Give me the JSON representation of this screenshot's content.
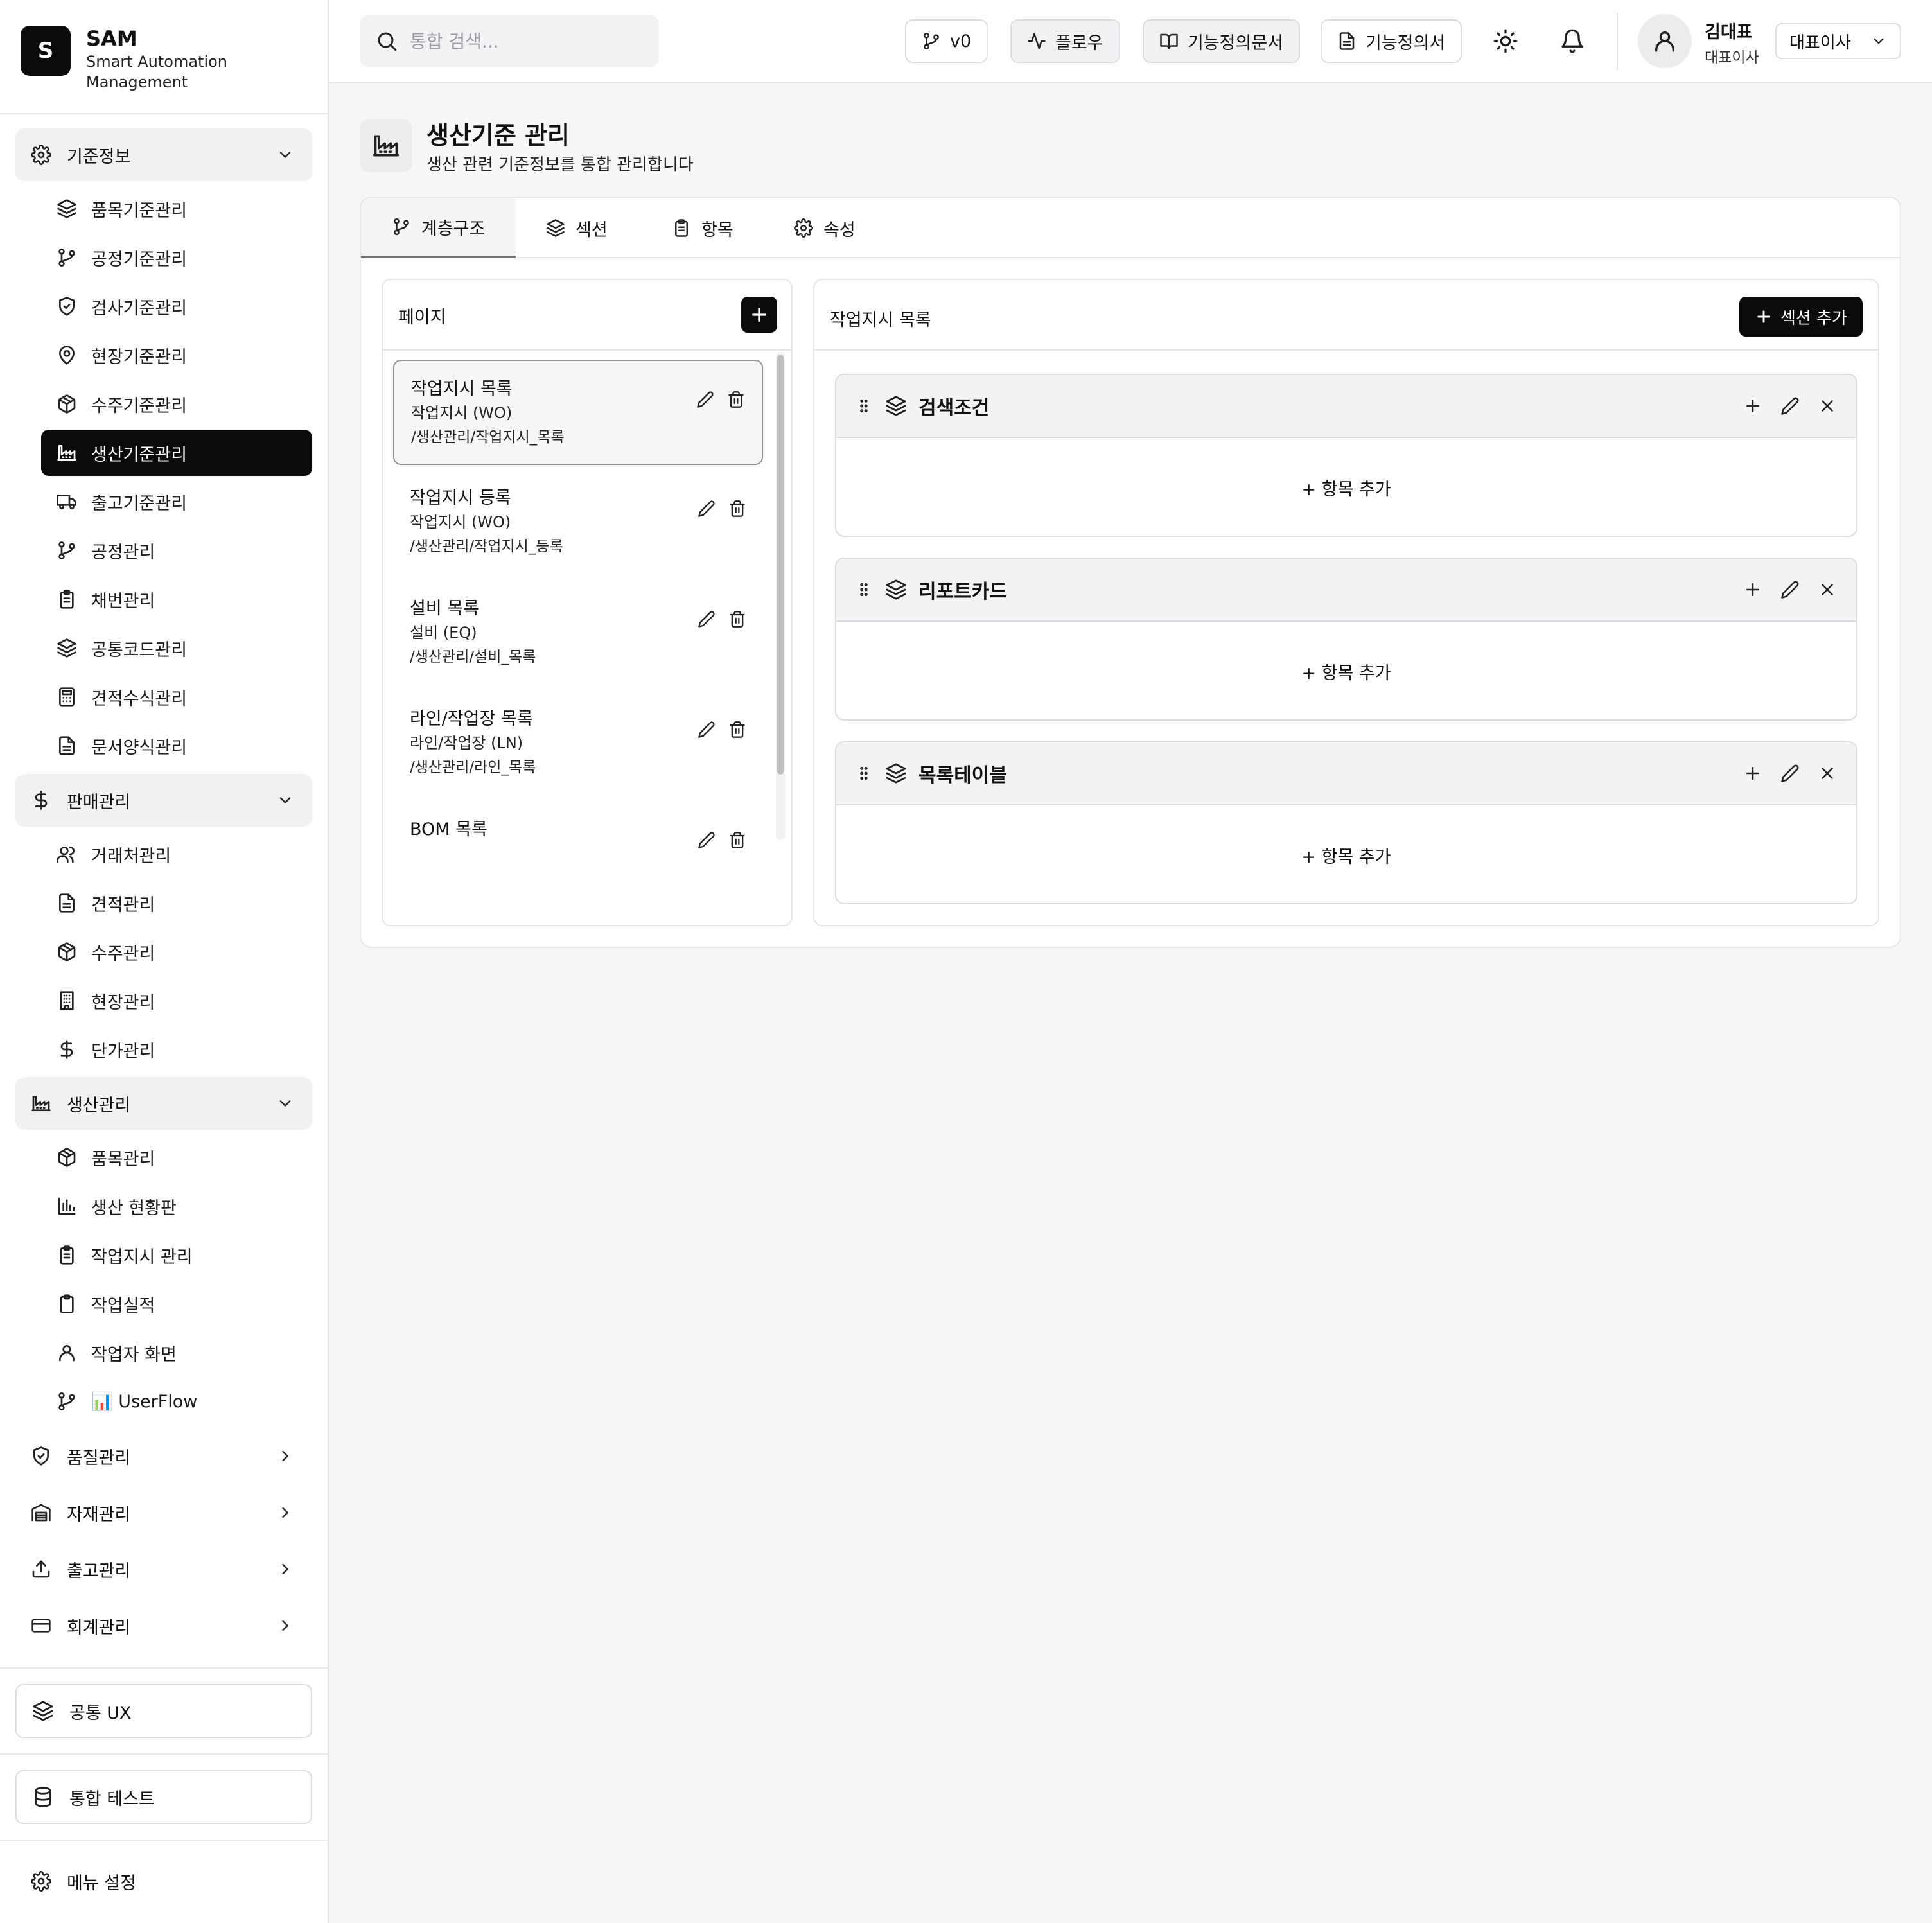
{
  "brand": {
    "logo_letter": "S",
    "name": "SAM",
    "subtitle": "Smart Automation Management"
  },
  "sidebar": {
    "groups": [
      {
        "label": "기준정보",
        "icon": "gear-icon",
        "expanded": true,
        "items": [
          {
            "label": "품목기준관리",
            "icon": "layers-icon"
          },
          {
            "label": "공정기준관리",
            "icon": "git-branch-icon"
          },
          {
            "label": "검사기준관리",
            "icon": "shield-icon"
          },
          {
            "label": "현장기준관리",
            "icon": "map-pin-icon"
          },
          {
            "label": "수주기준관리",
            "icon": "package-icon"
          },
          {
            "label": "생산기준관리",
            "icon": "factory-icon",
            "active": true
          },
          {
            "label": "출고기준관리",
            "icon": "truck-icon"
          },
          {
            "label": "공정관리",
            "icon": "git-branch-icon"
          },
          {
            "label": "채번관리",
            "icon": "clipboard-icon"
          },
          {
            "label": "공통코드관리",
            "icon": "layers-icon"
          },
          {
            "label": "견적수식관리",
            "icon": "calculator-icon"
          },
          {
            "label": "문서양식관리",
            "icon": "document-icon"
          }
        ]
      },
      {
        "label": "판매관리",
        "icon": "dollar-icon",
        "expanded": true,
        "items": [
          {
            "label": "거래처관리",
            "icon": "users-icon"
          },
          {
            "label": "견적관리",
            "icon": "document-icon"
          },
          {
            "label": "수주관리",
            "icon": "package-icon"
          },
          {
            "label": "현장관리",
            "icon": "building-icon"
          },
          {
            "label": "단가관리",
            "icon": "dollar-icon"
          }
        ]
      },
      {
        "label": "생산관리",
        "icon": "factory-icon",
        "expanded": true,
        "items": [
          {
            "label": "품목관리",
            "icon": "package-icon"
          },
          {
            "label": "생산 현황판",
            "icon": "bar-chart-icon"
          },
          {
            "label": "작업지시 관리",
            "icon": "clipboard-icon"
          },
          {
            "label": "작업실적",
            "icon": "clipboard-blank-icon"
          },
          {
            "label": "작업자 화면",
            "icon": "user-icon"
          },
          {
            "label": "📊 UserFlow",
            "icon": "git-branch-icon"
          }
        ]
      },
      {
        "label": "품질관리",
        "icon": "shield-check-icon",
        "expanded": false,
        "items": []
      },
      {
        "label": "자재관리",
        "icon": "warehouse-icon",
        "expanded": false,
        "items": []
      },
      {
        "label": "출고관리",
        "icon": "upload-icon",
        "expanded": false,
        "items": []
      },
      {
        "label": "회계관리",
        "icon": "credit-card-icon",
        "expanded": false,
        "items": []
      }
    ],
    "common_ux": "공통 UX",
    "integration_test": "통합 테스트",
    "menu_settings": "메뉴 설정"
  },
  "header": {
    "search_placeholder": "통합 검색...",
    "version_label": "v0",
    "flow_label": "플로우",
    "func_doc_label": "기능정의문서",
    "func_spec_label": "기능정의서",
    "user_name": "김대표",
    "user_role": "대표이사",
    "role_select_value": "대표이사"
  },
  "page": {
    "title": "생산기준 관리",
    "subtitle": "생산 관련 기준정보를 통합 관리합니다",
    "tabs": [
      {
        "label": "계층구조",
        "icon": "git-branch-icon",
        "active": true
      },
      {
        "label": "섹션",
        "icon": "layers-icon"
      },
      {
        "label": "항목",
        "icon": "clipboard-icon"
      },
      {
        "label": "속성",
        "icon": "gear-icon"
      }
    ]
  },
  "pages_panel": {
    "title": "페이지",
    "items": [
      {
        "title": "작업지시 목록",
        "sub": "작업지시 (WO)",
        "path": "/생산관리/작업지시_목록",
        "selected": true
      },
      {
        "title": "작업지시 등록",
        "sub": "작업지시 (WO)",
        "path": "/생산관리/작업지시_등록"
      },
      {
        "title": "설비 목록",
        "sub": "설비 (EQ)",
        "path": "/생산관리/설비_목록"
      },
      {
        "title": "라인/작업장 목록",
        "sub": "라인/작업장 (LN)",
        "path": "/생산관리/라인_목록"
      },
      {
        "title": "BOM 목록",
        "sub": "",
        "path": ""
      }
    ]
  },
  "sections_panel": {
    "title": "작업지시 목록",
    "add_section_label": "섹션 추가",
    "add_item_label": "+ 항목 추가",
    "sections": [
      {
        "title": "검색조건"
      },
      {
        "title": "리포트카드"
      },
      {
        "title": "목록테이블"
      }
    ]
  }
}
